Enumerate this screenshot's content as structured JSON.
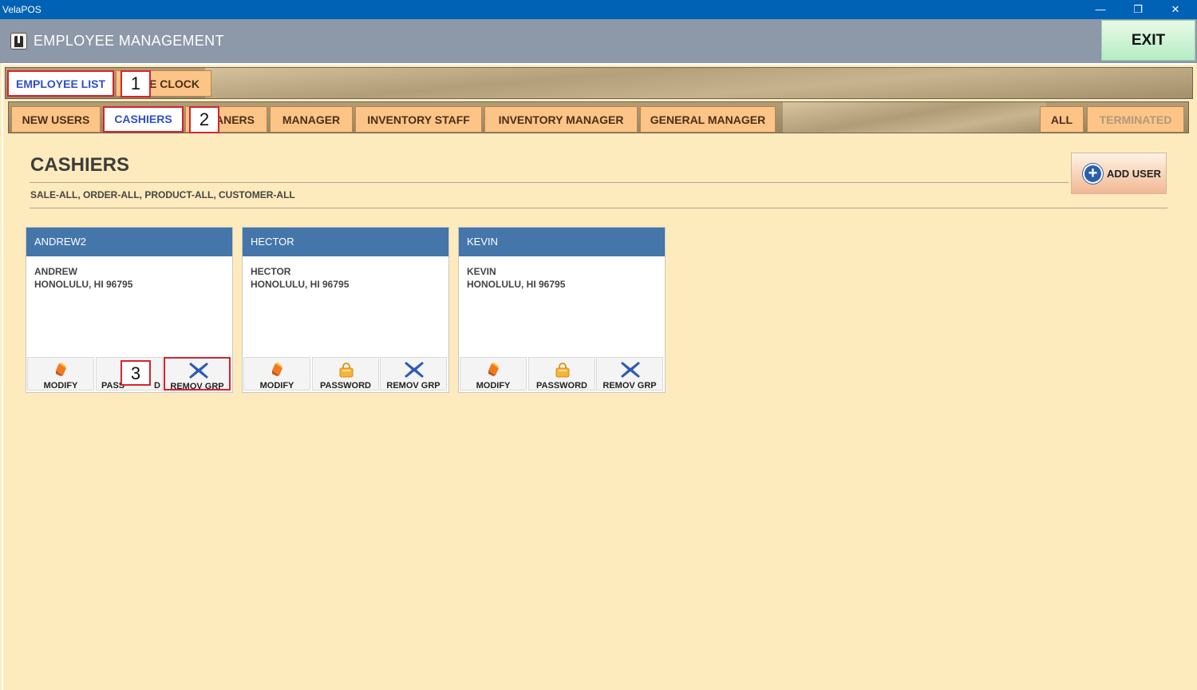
{
  "window": {
    "title": "VelaPOS",
    "minimize": "—",
    "maximize": "❐",
    "close": "✕"
  },
  "header": {
    "title": "EMPLOYEE MANAGEMENT",
    "exit_label": "EXIT"
  },
  "main_tabs": [
    {
      "label": "EMPLOYEE LIST",
      "selected": true
    },
    {
      "label": "E CLOCK",
      "selected": false
    }
  ],
  "role_tabs": [
    {
      "label": "NEW USERS"
    },
    {
      "label": "CASHIERS",
      "selected": true
    },
    {
      "label": "ANERS"
    },
    {
      "label": "MANAGER"
    },
    {
      "label": "INVENTORY STAFF"
    },
    {
      "label": "INVENTORY MANAGER"
    },
    {
      "label": "GENERAL MANAGER"
    },
    {
      "label": "ALL"
    },
    {
      "label": "TERMINATED",
      "disabled": true
    }
  ],
  "callouts": [
    "1",
    "2",
    "3"
  ],
  "section": {
    "title": "CASHIERS",
    "permissions": "SALE-ALL, ORDER-ALL, PRODUCT-ALL, CUSTOMER-ALL",
    "add_user_label": "ADD USER"
  },
  "employees": [
    {
      "username": "ANDREW2",
      "name": "ANDREW",
      "address": "HONOLULU, HI 96795",
      "actions": {
        "modify": "MODIFY",
        "password": "PASS",
        "password_tail": "D",
        "remove": "REMOV GRP"
      }
    },
    {
      "username": "HECTOR",
      "name": "HECTOR",
      "address": "HONOLULU, HI 96795",
      "actions": {
        "modify": "MODIFY",
        "password": "PASSWORD",
        "remove": "REMOV GRP"
      }
    },
    {
      "username": "KEVIN",
      "name": "KEVIN",
      "address": "HONOLULU, HI 96795",
      "actions": {
        "modify": "MODIFY",
        "password": "PASSWORD",
        "remove": "REMOV GRP"
      }
    }
  ],
  "colors": {
    "title_bar": "#0062b4",
    "header": "#8d98a8",
    "tab": "#fdc488",
    "card_header": "#4476aa",
    "highlight": "#d7232f",
    "background": "#fdebbd"
  }
}
